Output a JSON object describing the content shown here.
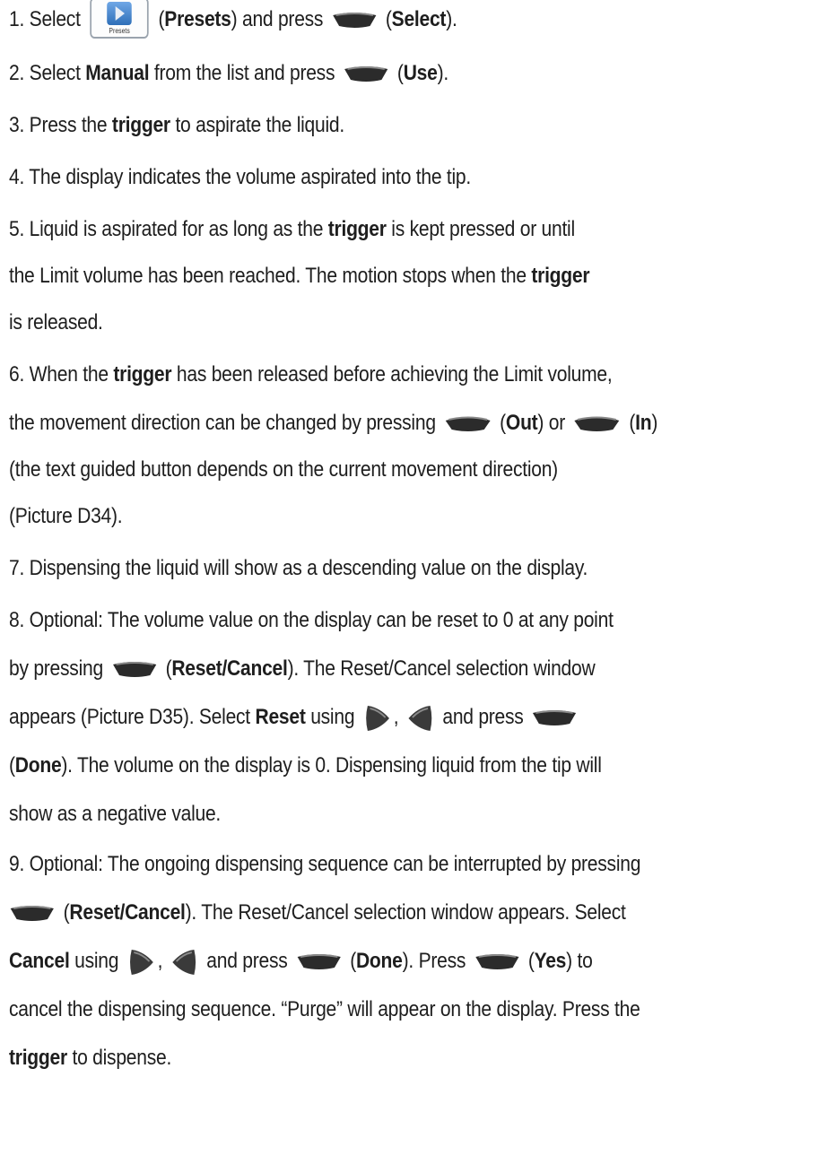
{
  "icons": {
    "softkey": "softkey-icon",
    "right_arrow": "right-arrow-key-icon",
    "left_arrow": "left-arrow-key-icon",
    "presets": "presets-key-icon",
    "presets_caption": "Presets"
  },
  "colors": {
    "key_dark": "#2b2b2b",
    "key_light": "#7a7a7a",
    "text": "#1e1e1e"
  },
  "lines": {
    "l1": {
      "a": "1.  Select ",
      "b": " (",
      "c": "Presets",
      "d": ") and press ",
      "e": " (",
      "f": "Select",
      "g": ")."
    },
    "l2": {
      "a": "2.  Select ",
      "b": "Manual",
      "c": " from the list and press ",
      "d": " (",
      "e": "Use",
      "f": ")."
    },
    "l3": {
      "a": "3.  Press the ",
      "b": "trigger",
      "c": " to aspirate the liquid."
    },
    "l4": {
      "a": "4.  The display indicates the volume aspirated into the tip."
    },
    "l5": {
      "a": "5.  Liquid is aspirated for as long as the ",
      "b": "trigger",
      "c": " is kept pressed or until"
    },
    "l6": {
      "a": "the Limit volume has been reached. The motion stops when the ",
      "b": "trigger"
    },
    "l7": {
      "a": "is released."
    },
    "l8": {
      "a": "6.  When the ",
      "b": "trigger",
      "c": " has been released before achieving the Limit volume,"
    },
    "l9": {
      "a": "the movement direction can be changed by pressing ",
      "b": " (",
      "c": "Out",
      "d": ") or ",
      "e": " (",
      "f": "In",
      "g": ")"
    },
    "l10": {
      "a": "(the text guided button depends on the current movement direction)"
    },
    "l11": {
      "a": "(Picture D34)."
    },
    "l12": {
      "a": "7.  Dispensing the liquid will show as a descending value on the display."
    },
    "l13": {
      "a": "8.  Optional: The volume value on the display can be reset to 0 at any point"
    },
    "l14": {
      "a": "by pressing ",
      "b": " (",
      "c": "Reset/Cancel",
      "d": "). The Reset/Cancel selection window"
    },
    "l15": {
      "a": "appears (Picture D35). Select ",
      "b": "Reset",
      "c": " using ",
      "d": ", ",
      "e": " and press "
    },
    "l16": {
      "a": "(",
      "b": "Done",
      "c": "). The volume on the display is 0. Dispensing liquid from the tip will"
    },
    "l17": {
      "a": "show as a negative value."
    },
    "l18": {
      "a": "9.  Optional: The ongoing dispensing sequence can be interrupted by pressing"
    },
    "l19": {
      "a": " (",
      "b": "Reset/Cancel",
      "c": "). The Reset/Cancel selection window appears. Select"
    },
    "l20": {
      "a": "Cancel",
      "b": " using ",
      "c": ", ",
      "d": " and press ",
      "e": " (",
      "f": "Done",
      "g": "). Press ",
      "h": " (",
      "i": "Yes",
      "j": ") to"
    },
    "l21": {
      "a": "cancel the dispensing sequence. “Purge” will appear on the display. Press the"
    },
    "l22": {
      "a": "trigger",
      "b": " to dispense."
    }
  }
}
